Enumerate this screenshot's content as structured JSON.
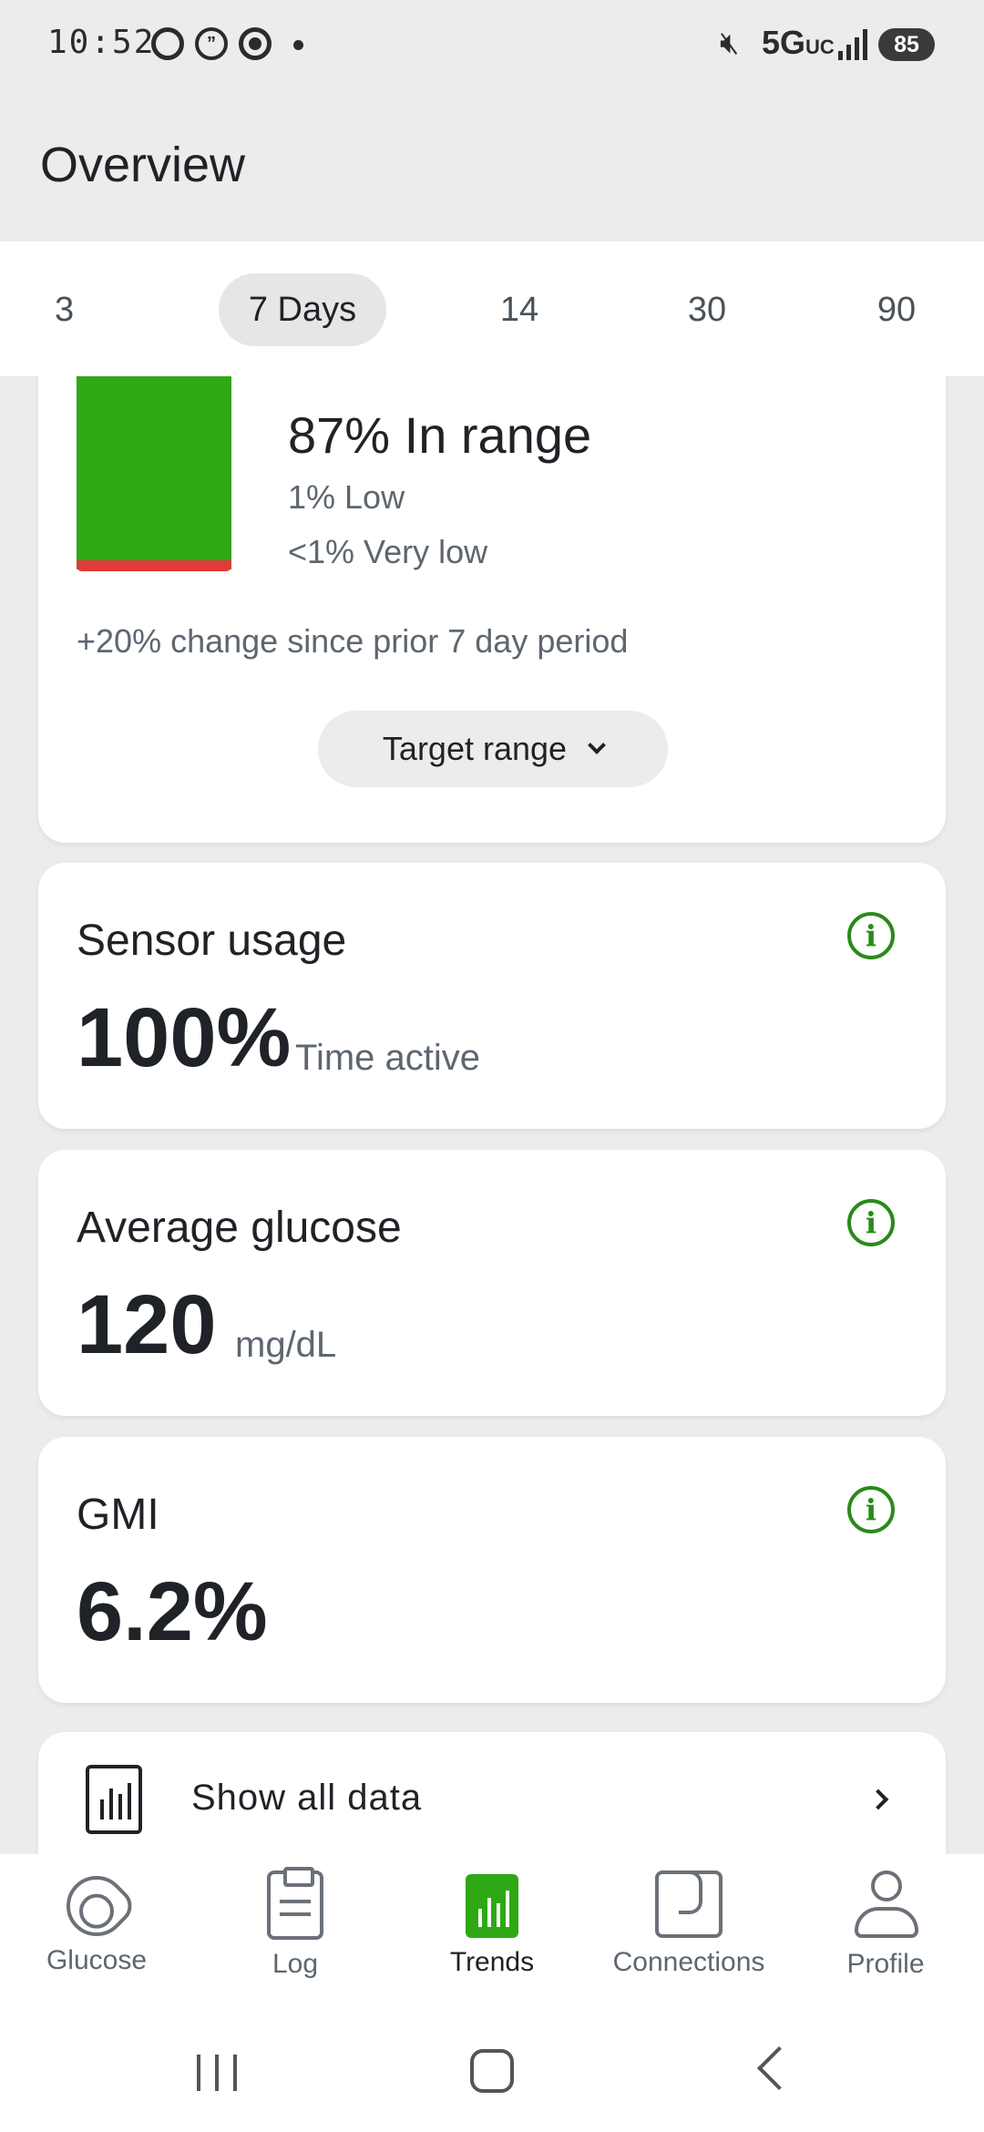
{
  "status_bar": {
    "time": "10:52",
    "network": "5G",
    "network_sub": "UC",
    "battery": "85"
  },
  "header": {
    "title": "Overview"
  },
  "range_tabs": [
    "3",
    "7 Days",
    "14",
    "30",
    "90"
  ],
  "range_tabs_active": "7 Days",
  "time_in_range": {
    "in_range": "87% In range",
    "low": "1% Low",
    "very_low": "<1% Very low",
    "change": "+20% change since prior 7 day period",
    "target_button": "Target range",
    "in_range_pct": 87,
    "low_pct": 1,
    "colors": {
      "in_range": "#2ea915",
      "low": "#e03a3a"
    }
  },
  "sensor_usage": {
    "title": "Sensor usage",
    "value": "100%",
    "unit": "Time active"
  },
  "average_glucose": {
    "title": "Average glucose",
    "value": "120",
    "unit": "mg/dL"
  },
  "gmi": {
    "title": "GMI",
    "value": "6.2%"
  },
  "show_all": {
    "label": "Show all data"
  },
  "bottom_nav": [
    {
      "label": "Glucose",
      "icon": "glucose-icon"
    },
    {
      "label": "Log",
      "icon": "clipboard-icon"
    },
    {
      "label": "Trends",
      "icon": "bar-chart-icon",
      "active": true
    },
    {
      "label": "Connections",
      "icon": "connections-icon"
    },
    {
      "label": "Profile",
      "icon": "person-icon"
    }
  ],
  "colors": {
    "accent": "#2ea915",
    "info": "#2a8a1a"
  }
}
